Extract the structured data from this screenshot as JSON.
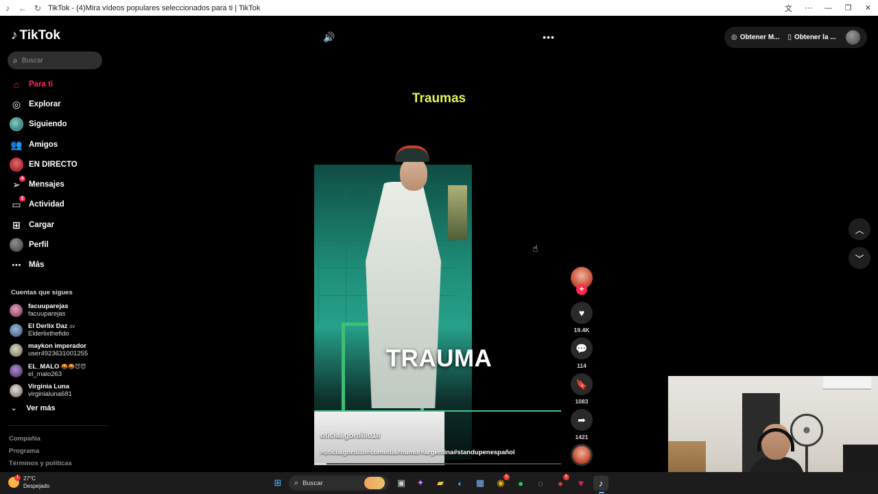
{
  "browser": {
    "tab_title": "TikTok - (4)Mira vídeos populares seleccionados para ti | TikTok"
  },
  "sidebar": {
    "logo_text": "TikTok",
    "search_placeholder": "Buscar",
    "nav": [
      {
        "label": "Para ti",
        "icon": "home-icon",
        "active": true
      },
      {
        "label": "Explorar",
        "icon": "compass-icon"
      },
      {
        "label": "Siguiendo",
        "icon": "following-avatar-icon"
      },
      {
        "label": "Amigos",
        "icon": "friends-icon"
      },
      {
        "label": "EN DIRECTO",
        "icon": "live-avatar-icon"
      },
      {
        "label": "Mensajes",
        "icon": "send-icon",
        "badge": "4"
      },
      {
        "label": "Actividad",
        "icon": "inbox-icon",
        "badge": "1"
      },
      {
        "label": "Cargar",
        "icon": "upload-icon"
      },
      {
        "label": "Perfil",
        "icon": "profile-avatar-icon"
      },
      {
        "label": "Más",
        "icon": "more-dots-icon"
      }
    ],
    "following_title": "Cuentas que sigues",
    "following": [
      {
        "name": "facuuparejas",
        "handle": "facuuparejas",
        "extra": ""
      },
      {
        "name": "El Derlix Daz",
        "handle": "Elderlixthefido",
        "extra": "sv"
      },
      {
        "name": "maykon imperador",
        "handle": "user4923631001255",
        "extra": ""
      },
      {
        "name": "EL_MALO",
        "handle": "el_malo263",
        "extra": "🤬🤬😈😈"
      },
      {
        "name": "Virginia Luna",
        "handle": "virginialuna681",
        "extra": ""
      }
    ],
    "see_more": "Ver más",
    "footer": [
      "Compañía",
      "Programa",
      "Términos y políticas"
    ]
  },
  "header": {
    "actions": [
      "Obtener M...",
      "Obtener la ..."
    ]
  },
  "video": {
    "title": "Traumas",
    "caption_overlay": "TRAUMA",
    "author": "oficial.gordillo18",
    "hashtags": "#oficialgordillo#comedia#humor#argentina#standupenespañol",
    "progress": 0.05,
    "counts": {
      "likes": "19.4K",
      "comments": "114",
      "saves": "1083",
      "shares": "1421"
    }
  },
  "taskbar": {
    "temperature": "27°C",
    "weather": "Despejado",
    "weather_badge": "1",
    "search_label": "Buscar",
    "chrome_badge": "5",
    "app_badge": "5"
  },
  "colors": {
    "accent": "#fe2c55",
    "title_yellow": "#e7f25d"
  }
}
